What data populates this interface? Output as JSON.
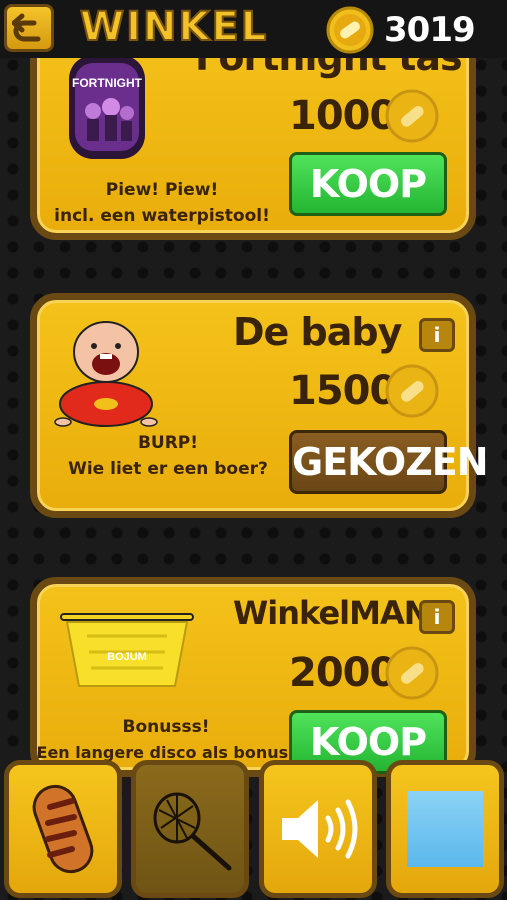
{
  "header": {
    "title": "WINKEL",
    "coins": "3019",
    "back_icon": "back-arrow-icon"
  },
  "items": [
    {
      "name": "Fortnight tas",
      "price": "1000",
      "description_line1": "Piew! Piew!",
      "description_line2": "incl. een waterpistool!",
      "button": "KOOP",
      "button_state": "buy",
      "image_text": "FORTNIGHT"
    },
    {
      "name": "De baby",
      "price": "1500",
      "description_line1": "BURP!",
      "description_line2": "Wie liet er een boer?",
      "button": "GEKOZEN",
      "button_state": "selected",
      "info": "i"
    },
    {
      "name": "WinkelMAND",
      "price": "2000",
      "description_line1": "Bonusss!",
      "description_line2": "Een langere disco als bonus!",
      "button": "KOOP",
      "button_state": "buy",
      "info": "i",
      "image_text": "BOJUM"
    }
  ],
  "toolbar": [
    {
      "icon": "bread-icon",
      "state": "active"
    },
    {
      "icon": "net-icon",
      "state": "inactive"
    },
    {
      "icon": "speaker-icon",
      "state": "active"
    },
    {
      "icon": "blue-square-icon",
      "state": "active"
    }
  ],
  "colors": {
    "gold": "#f4c21a",
    "border": "#6a4a12",
    "green": "#35c93f",
    "text": "#3a230b"
  }
}
